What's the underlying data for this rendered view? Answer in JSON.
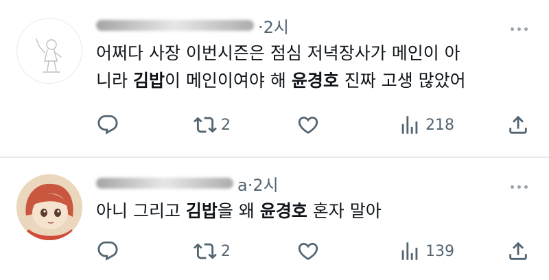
{
  "posts": [
    {
      "time": "·2시",
      "text_parts": [
        {
          "t": "어쩌다 사장 이번시즌은  점심 저녁장사가 메인이 아",
          "b": false
        },
        {
          "t": "\n",
          "b": false
        },
        {
          "t": "니라 ",
          "b": false
        },
        {
          "t": "김밥",
          "b": true
        },
        {
          "t": "이 메인이여야 해 ",
          "b": false
        },
        {
          "t": "윤경호",
          "b": true
        },
        {
          "t": " 진짜 고생 많았어",
          "b": false
        }
      ],
      "actions": {
        "retweet_count": "2",
        "like_count": "",
        "views_count": "218"
      }
    },
    {
      "time": "a·2시",
      "text_parts": [
        {
          "t": "아니 그리고 ",
          "b": false
        },
        {
          "t": "김밥",
          "b": true
        },
        {
          "t": "을 왜 ",
          "b": false
        },
        {
          "t": "윤경호",
          "b": true
        },
        {
          "t": " 혼자 말아",
          "b": false
        }
      ],
      "actions": {
        "retweet_count": "2",
        "like_count": "",
        "views_count": "139"
      }
    }
  ],
  "icons": {
    "reply": "reply-icon",
    "retweet": "retweet-icon",
    "like": "heart-icon",
    "views": "views-chart-icon",
    "share": "share-icon",
    "more": "more-dots-icon"
  },
  "colors": {
    "text": "#0f1419",
    "muted": "#536471",
    "divider": "#e8ebed"
  }
}
